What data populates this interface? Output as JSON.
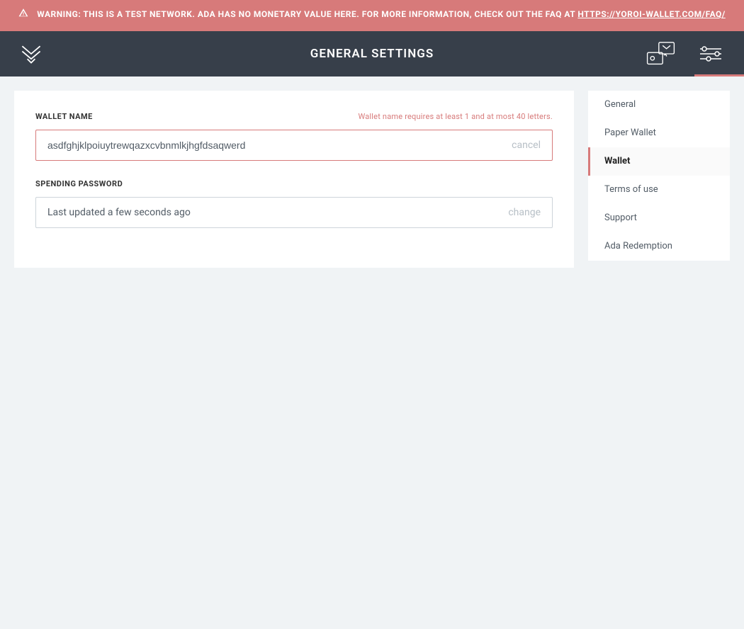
{
  "warning": {
    "text": "WARNING: THIS IS A TEST NETWORK. ADA HAS NO MONETARY VALUE HERE. FOR MORE INFORMATION, CHECK OUT THE FAQ AT ",
    "link_label": "HTTPS://YOROI-WALLET.COM/FAQ/"
  },
  "header": {
    "title": "GENERAL SETTINGS"
  },
  "walletName": {
    "label": "WALLET NAME",
    "error": "Wallet name requires at least 1 and at most 40 letters.",
    "value": "asdfghjklpoiuytrewqazxcvbnmlkjhgfdsaqwerd",
    "action": "cancel"
  },
  "spendingPassword": {
    "label": "SPENDING PASSWORD",
    "status": "Last updated a few seconds ago",
    "action": "change"
  },
  "sidenav": {
    "items": [
      {
        "label": "General"
      },
      {
        "label": "Paper Wallet"
      },
      {
        "label": "Wallet"
      },
      {
        "label": "Terms of use"
      },
      {
        "label": "Support"
      },
      {
        "label": "Ada Redemption"
      }
    ],
    "activeIndex": 2
  }
}
